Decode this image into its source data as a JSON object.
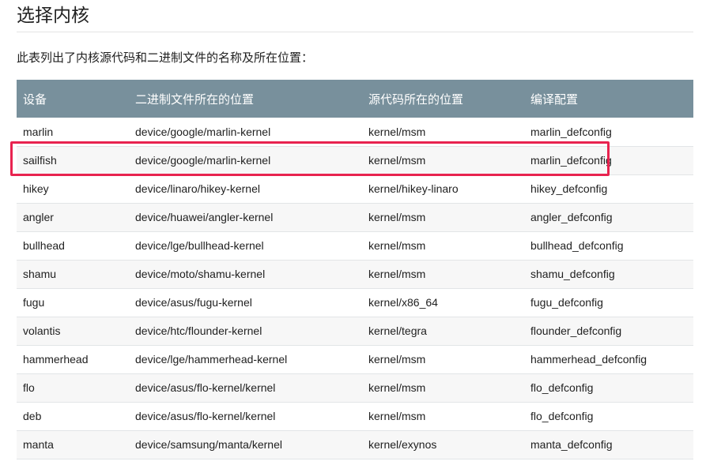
{
  "page": {
    "title": "选择内核",
    "intro": "此表列出了内核源代码和二进制文件的名称及所在位置："
  },
  "table": {
    "headers": [
      "设备",
      "二进制文件所在的位置",
      "源代码所在的位置",
      "编译配置"
    ],
    "rows": [
      [
        "marlin",
        "device/google/marlin-kernel",
        "kernel/msm",
        "marlin_defconfig"
      ],
      [
        "sailfish",
        "device/google/marlin-kernel",
        "kernel/msm",
        "marlin_defconfig"
      ],
      [
        "hikey",
        "device/linaro/hikey-kernel",
        "kernel/hikey-linaro",
        "hikey_defconfig"
      ],
      [
        "angler",
        "device/huawei/angler-kernel",
        "kernel/msm",
        "angler_defconfig"
      ],
      [
        "bullhead",
        "device/lge/bullhead-kernel",
        "kernel/msm",
        "bullhead_defconfig"
      ],
      [
        "shamu",
        "device/moto/shamu-kernel",
        "kernel/msm",
        "shamu_defconfig"
      ],
      [
        "fugu",
        "device/asus/fugu-kernel",
        "kernel/x86_64",
        "fugu_defconfig"
      ],
      [
        "volantis",
        "device/htc/flounder-kernel",
        "kernel/tegra",
        "flounder_defconfig"
      ],
      [
        "hammerhead",
        "device/lge/hammerhead-kernel",
        "kernel/msm",
        "hammerhead_defconfig"
      ],
      [
        "flo",
        "device/asus/flo-kernel/kernel",
        "kernel/msm",
        "flo_defconfig"
      ],
      [
        "deb",
        "device/asus/flo-kernel/kernel",
        "kernel/msm",
        "flo_defconfig"
      ],
      [
        "manta",
        "device/samsung/manta/kernel",
        "kernel/exynos",
        "manta_defconfig"
      ]
    ]
  },
  "colors": {
    "header_bg": "#78909c",
    "highlight": "#e8234f"
  }
}
